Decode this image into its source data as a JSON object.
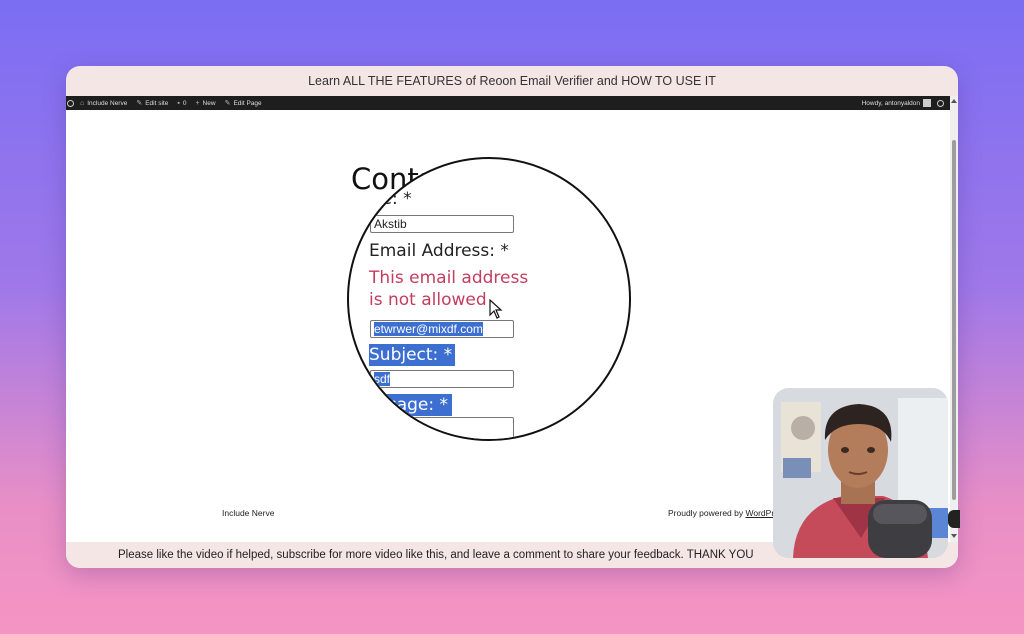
{
  "video_title": "Learn ALL THE FEATURES of Reoon Email Verifier and HOW TO USE IT",
  "adminbar": {
    "items": [
      {
        "label": "Include Nerve",
        "icon": "dashboard-icon"
      },
      {
        "label": "Edit site",
        "icon": "pencil-icon"
      },
      {
        "label": "0",
        "icon": "comment-icon"
      },
      {
        "label": "New",
        "icon": "plus-icon"
      },
      {
        "label": "Edit Page",
        "icon": "pencil-icon"
      }
    ],
    "greeting": "Howdy, antonyaldon"
  },
  "page": {
    "heading": "Conta",
    "footer_left": "Include Nerve",
    "footer_right_prefix": "Proudly powered by ",
    "footer_right_link": "WordPr"
  },
  "magnifier": {
    "name_label": "me: *",
    "name_value": "Akstib",
    "email_label": "Email Address: *",
    "error_line1": "This email address",
    "error_line2": "is not allowed",
    "email_value": "etwrwer@mixdf.com",
    "subject_label": "Subject: *",
    "subject_value": "sdf",
    "message_label": "ssage: *"
  },
  "caption": "Please like the video if helped, subscribe for more video like this, and leave a comment to share your feedback. THANK YOU",
  "colors": {
    "background_top": "#7b6ef3",
    "background_bottom": "#f494c4",
    "frame": "#f4e6e4",
    "selection": "#3d6fd1",
    "error": "#c33d5f"
  }
}
